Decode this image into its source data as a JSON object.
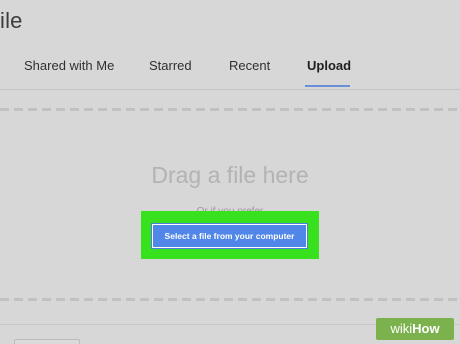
{
  "window": {
    "title": "ile"
  },
  "tabs": [
    {
      "label": "Shared with Me"
    },
    {
      "label": "Starred"
    },
    {
      "label": "Recent"
    },
    {
      "label": "Upload",
      "active": true
    }
  ],
  "dropzone": {
    "heading": "Drag a file here",
    "or_text": "Or if you prefer",
    "select_button_label": "Select a file from your computer"
  },
  "watermark": {
    "wiki": "wiki",
    "how": "How"
  },
  "colors": {
    "accent": "#4f86e8",
    "highlight": "#37e11d",
    "tab_underline": "#6a8fd6",
    "background": "#d7d7d7",
    "watermark": "#7bb24d"
  }
}
